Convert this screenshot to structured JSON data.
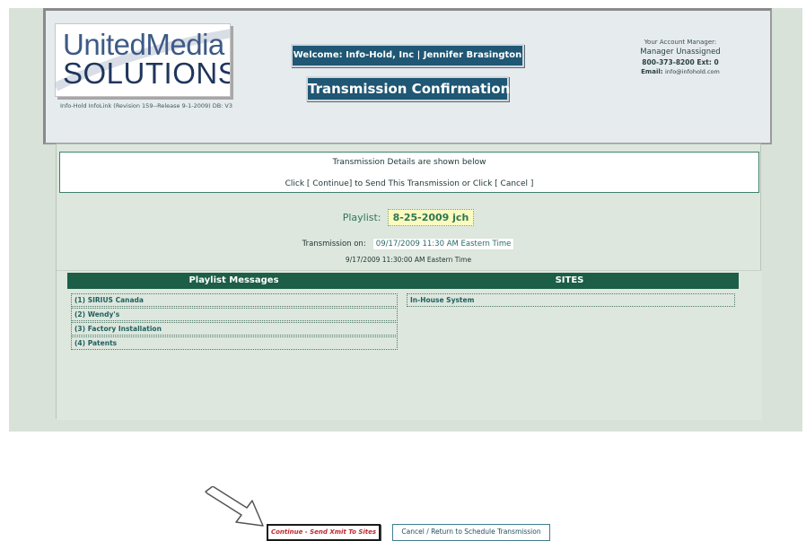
{
  "header": {
    "logo": {
      "line1": "UnitedMedia",
      "line2": "SOLUTIONS"
    },
    "version_text": "Info-Hold InfoLink (Revision 159--Release 9-1-2009) DB: V3",
    "welcome": "Welcome: Info-Hold, Inc  |  Jennifer Brasington",
    "page_title": "Transmission Confirmation",
    "account_manager": {
      "label": "Your Account Manager:",
      "name": "Manager Unassigned",
      "phone": "800-373-8200 Ext: 0",
      "email_label": "Email:",
      "email": "info@infohold.com"
    }
  },
  "details": {
    "line1": "Transmission Details are shown below",
    "line2": "Click [ Continue] to Send This Transmission or Click [ Cancel ]"
  },
  "playlist": {
    "label": "Playlist:",
    "value": "8-25-2009 jch"
  },
  "transmission": {
    "label": "Transmission on:",
    "value": "09/17/2009 11:30 AM Eastern Time"
  },
  "timestamp": "9/17/2009 11:30:00 AM Eastern Time",
  "messages": {
    "header": "Playlist Messages",
    "items": [
      {
        "num": "(1)",
        "text": "SIRIUS Canada"
      },
      {
        "num": "(2)",
        "text": "Wendy's"
      },
      {
        "num": "(3)",
        "text": "Factory Installation"
      },
      {
        "num": "(4)",
        "text": "Patents"
      }
    ]
  },
  "sites": {
    "header": "SITES",
    "items": [
      "In-House System"
    ]
  },
  "buttons": {
    "continue": "Continue - Send Xmit To Sites",
    "cancel": "Cancel / Return to Schedule Transmission"
  },
  "icons": {
    "pointer_arrow": "arrow-icon"
  },
  "colors": {
    "banner": "#1f5774",
    "list_header": "#1c5e47",
    "continue_text": "#c2262c",
    "playlist_highlight": "#fbfbbf"
  }
}
